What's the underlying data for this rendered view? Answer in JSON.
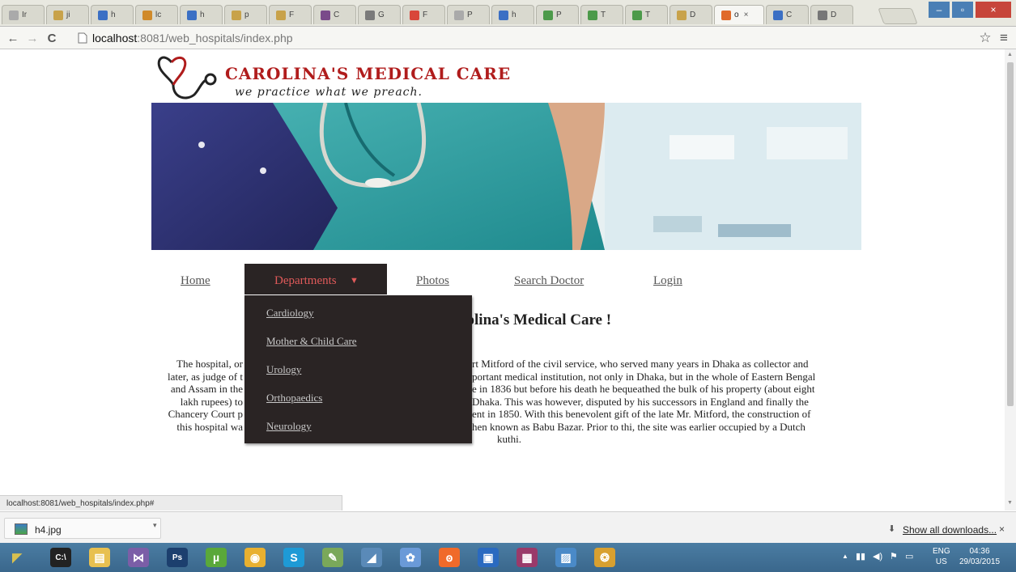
{
  "browser": {
    "tabs": [
      {
        "label": "Ir",
        "color": "#aaaaaa"
      },
      {
        "label": "ji",
        "color": "#c8a24a"
      },
      {
        "label": "h",
        "color": "#3b6fc4"
      },
      {
        "label": "lc",
        "color": "#d08a2a"
      },
      {
        "label": "h",
        "color": "#3b6fc4"
      },
      {
        "label": "p",
        "color": "#c8a24a"
      },
      {
        "label": "F",
        "color": "#c8a24a"
      },
      {
        "label": "C",
        "color": "#7a4a8a"
      },
      {
        "label": "G",
        "color": "#7a7a7a"
      },
      {
        "label": "F",
        "color": "#d9463a"
      },
      {
        "label": "P",
        "color": "#aaaaaa"
      },
      {
        "label": "h",
        "color": "#3b6fc4"
      },
      {
        "label": "P",
        "color": "#4c9a4a"
      },
      {
        "label": "T",
        "color": "#4c9a4a"
      },
      {
        "label": "T",
        "color": "#4c9a4a"
      },
      {
        "label": "D",
        "color": "#c8a24a"
      },
      {
        "label": "o",
        "color": "#e06a2a"
      },
      {
        "label": "C",
        "color": "#3b6fc4"
      },
      {
        "label": "D",
        "color": "#777777"
      }
    ],
    "active_tab_index": 16,
    "active_tab_close": "×",
    "url_host": "localhost",
    "url_rest": ":8081/web_hospitals/index.php",
    "back_icon": "←",
    "forward_icon": "→",
    "reload_icon": "C",
    "star_icon": "☆",
    "menu_icon": "≡",
    "window": {
      "minimize": "–",
      "restore": "▫",
      "close": "×"
    }
  },
  "site": {
    "title": "CAROLINA'S MEDICAL CARE",
    "tagline": "we practice what we preach.",
    "nav": {
      "home": "Home",
      "departments": "Departments",
      "departments_caret": "▼",
      "photos": "Photos",
      "search_doctor": "Search Doctor",
      "login": "Login"
    },
    "departments_menu": [
      "Cardiology",
      "Mother & Child Care",
      "Urology",
      "Orthopaedics",
      "Neurology"
    ],
    "welcome_visible": "arolina's Medical Care !",
    "intro_lines": [
      [
        "The hospital, or",
        "rt Mitford of the civil service, who served many years in Dhaka as collector and"
      ],
      [
        "later, as judge of t",
        "portant medical institution, not only in Dhaka, but in the whole of Eastern Bengal"
      ],
      [
        "and Assam in the",
        "e in 1836 but before his death he bequeathed the bulk of his property (about eight"
      ],
      [
        "lakh rupees) to",
        "Dhaka. This was however, disputed by his successors in England and finally the"
      ],
      [
        "Chancery Court p",
        "ent in 1850. With this benevolent gift of the late Mr. Mitford, the construction of"
      ],
      [
        "this hospital wa",
        "hen known as Babu Bazar. Prior to thi, the site was earlier occupied by a Dutch"
      ],
      [
        "",
        "kuthi."
      ]
    ]
  },
  "status_text": "localhost:8081/web_hospitals/index.php#",
  "downloads": {
    "file_name": "h4.jpg",
    "show_all": "Show all downloads...",
    "close": "×"
  },
  "taskbar": {
    "apps": [
      {
        "name": "cmd",
        "glyph": "C:\\",
        "color": "#222222"
      },
      {
        "name": "explorer",
        "glyph": "▤",
        "color": "#e8c050"
      },
      {
        "name": "visual-studio",
        "glyph": "⋈",
        "color": "#7b5ea7"
      },
      {
        "name": "photoshop",
        "glyph": "Ps",
        "color": "#1c3f6e"
      },
      {
        "name": "utorrent",
        "glyph": "µ",
        "color": "#5aa83a"
      },
      {
        "name": "chrome",
        "glyph": "◉",
        "color": "#e8b030"
      },
      {
        "name": "skype",
        "glyph": "S",
        "color": "#1e9ad6"
      },
      {
        "name": "notepad",
        "glyph": "✎",
        "color": "#7aa85a"
      },
      {
        "name": "winamp",
        "glyph": "◢",
        "color": "#5a8ab8"
      },
      {
        "name": "paint",
        "glyph": "✿",
        "color": "#6a9ad8"
      },
      {
        "name": "xampp",
        "glyph": "ꙩ",
        "color": "#f06a2a"
      },
      {
        "name": "virtualbox",
        "glyph": "▣",
        "color": "#2a6ac0"
      },
      {
        "name": "winrar",
        "glyph": "▦",
        "color": "#9a3a6a"
      },
      {
        "name": "photo-viewer",
        "glyph": "▨",
        "color": "#4a8ac8"
      },
      {
        "name": "picasa",
        "glyph": "❂",
        "color": "#d8a030"
      }
    ],
    "lang_line1": "ENG",
    "lang_line2": "US",
    "time": "04:36",
    "date": "29/03/2015"
  }
}
